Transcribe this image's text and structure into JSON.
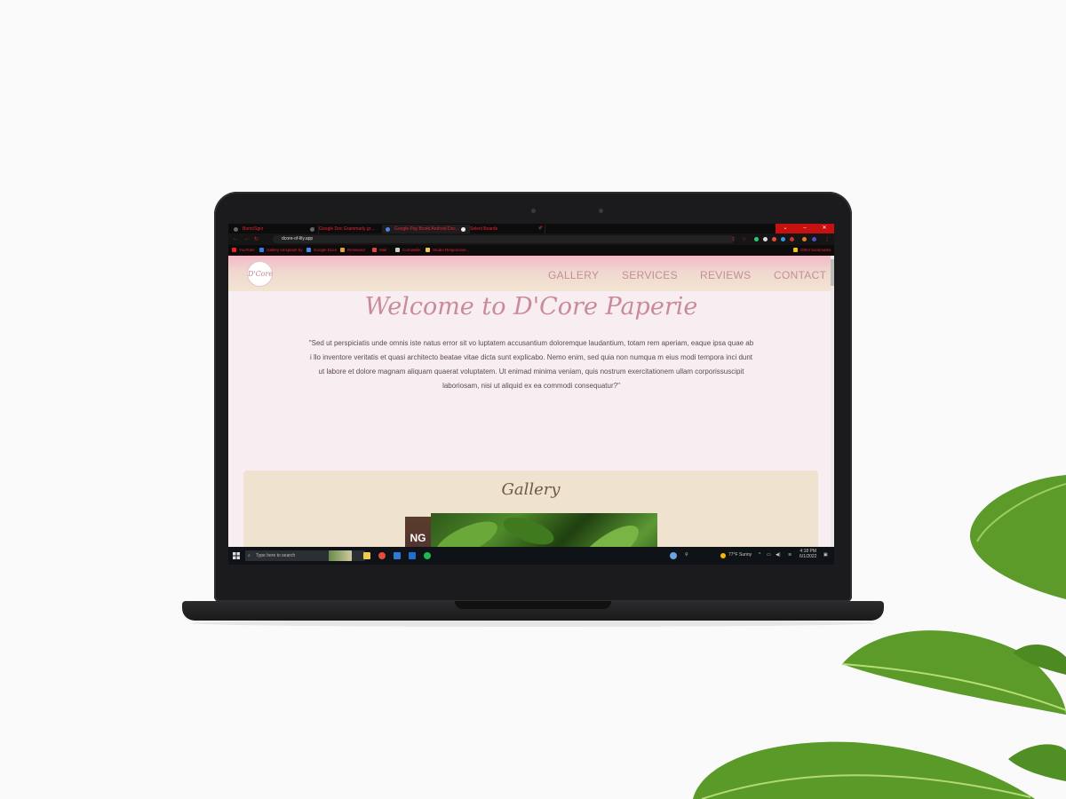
{
  "browser": {
    "tabs": [
      {
        "label": "Bonn/Sgrz"
      },
      {
        "label": "Google Doc Grammarly gr..."
      },
      {
        "label": "Google Pay Bookt Android Doc..."
      },
      {
        "label": "Select Boards"
      }
    ],
    "window_controls": [
      "⌄",
      "–",
      "❐",
      "✕"
    ],
    "address": "dcore-of-lily.app",
    "bookmarks": [
      "YouTube",
      "Gallery-Unsplash by",
      "Google Docs",
      "Reviewed",
      "Mail",
      "Cornwalle",
      "Studio Responsive..."
    ],
    "bookmarks_right": "Other bookmarks"
  },
  "site": {
    "logo_text": "D'Core",
    "nav": [
      "GALLERY",
      "SERVICES",
      "REVIEWS",
      "CONTACT"
    ],
    "welcome": "Welcome to D'Core Paperie",
    "quote": "\"Sed ut perspiciatis unde omnis iste natus error sit vo luptatem accusantium doloremque laudantium, totam rem aperiam, eaque ipsa quae ab i llo inventore veritatis et quasi architecto beatae vitae dicta sunt explicabo. Nemo enim, sed quia non numqua m eius modi tempora inci dunt ut labore et dolore magnam aliquam quaerat voluptatem. Ut enimad minima veniam, quis nostrum exercitationem ullam corporissuscipit laboriosam, nisi ut aliquid ex ea commodi consequatur?\"",
    "gallery_title": "Gallery",
    "photo_side_text": "NG"
  },
  "taskbar": {
    "search_placeholder": "Type here to search",
    "weather": "77°F Sunny",
    "time": "4:18 PM",
    "date": "6/1/2022"
  },
  "colors": {
    "accent_pink": "#c98a9a",
    "nav_text": "#c09096",
    "gallery_bg": "#efe2cf",
    "page_bg": "#f8eef1"
  }
}
